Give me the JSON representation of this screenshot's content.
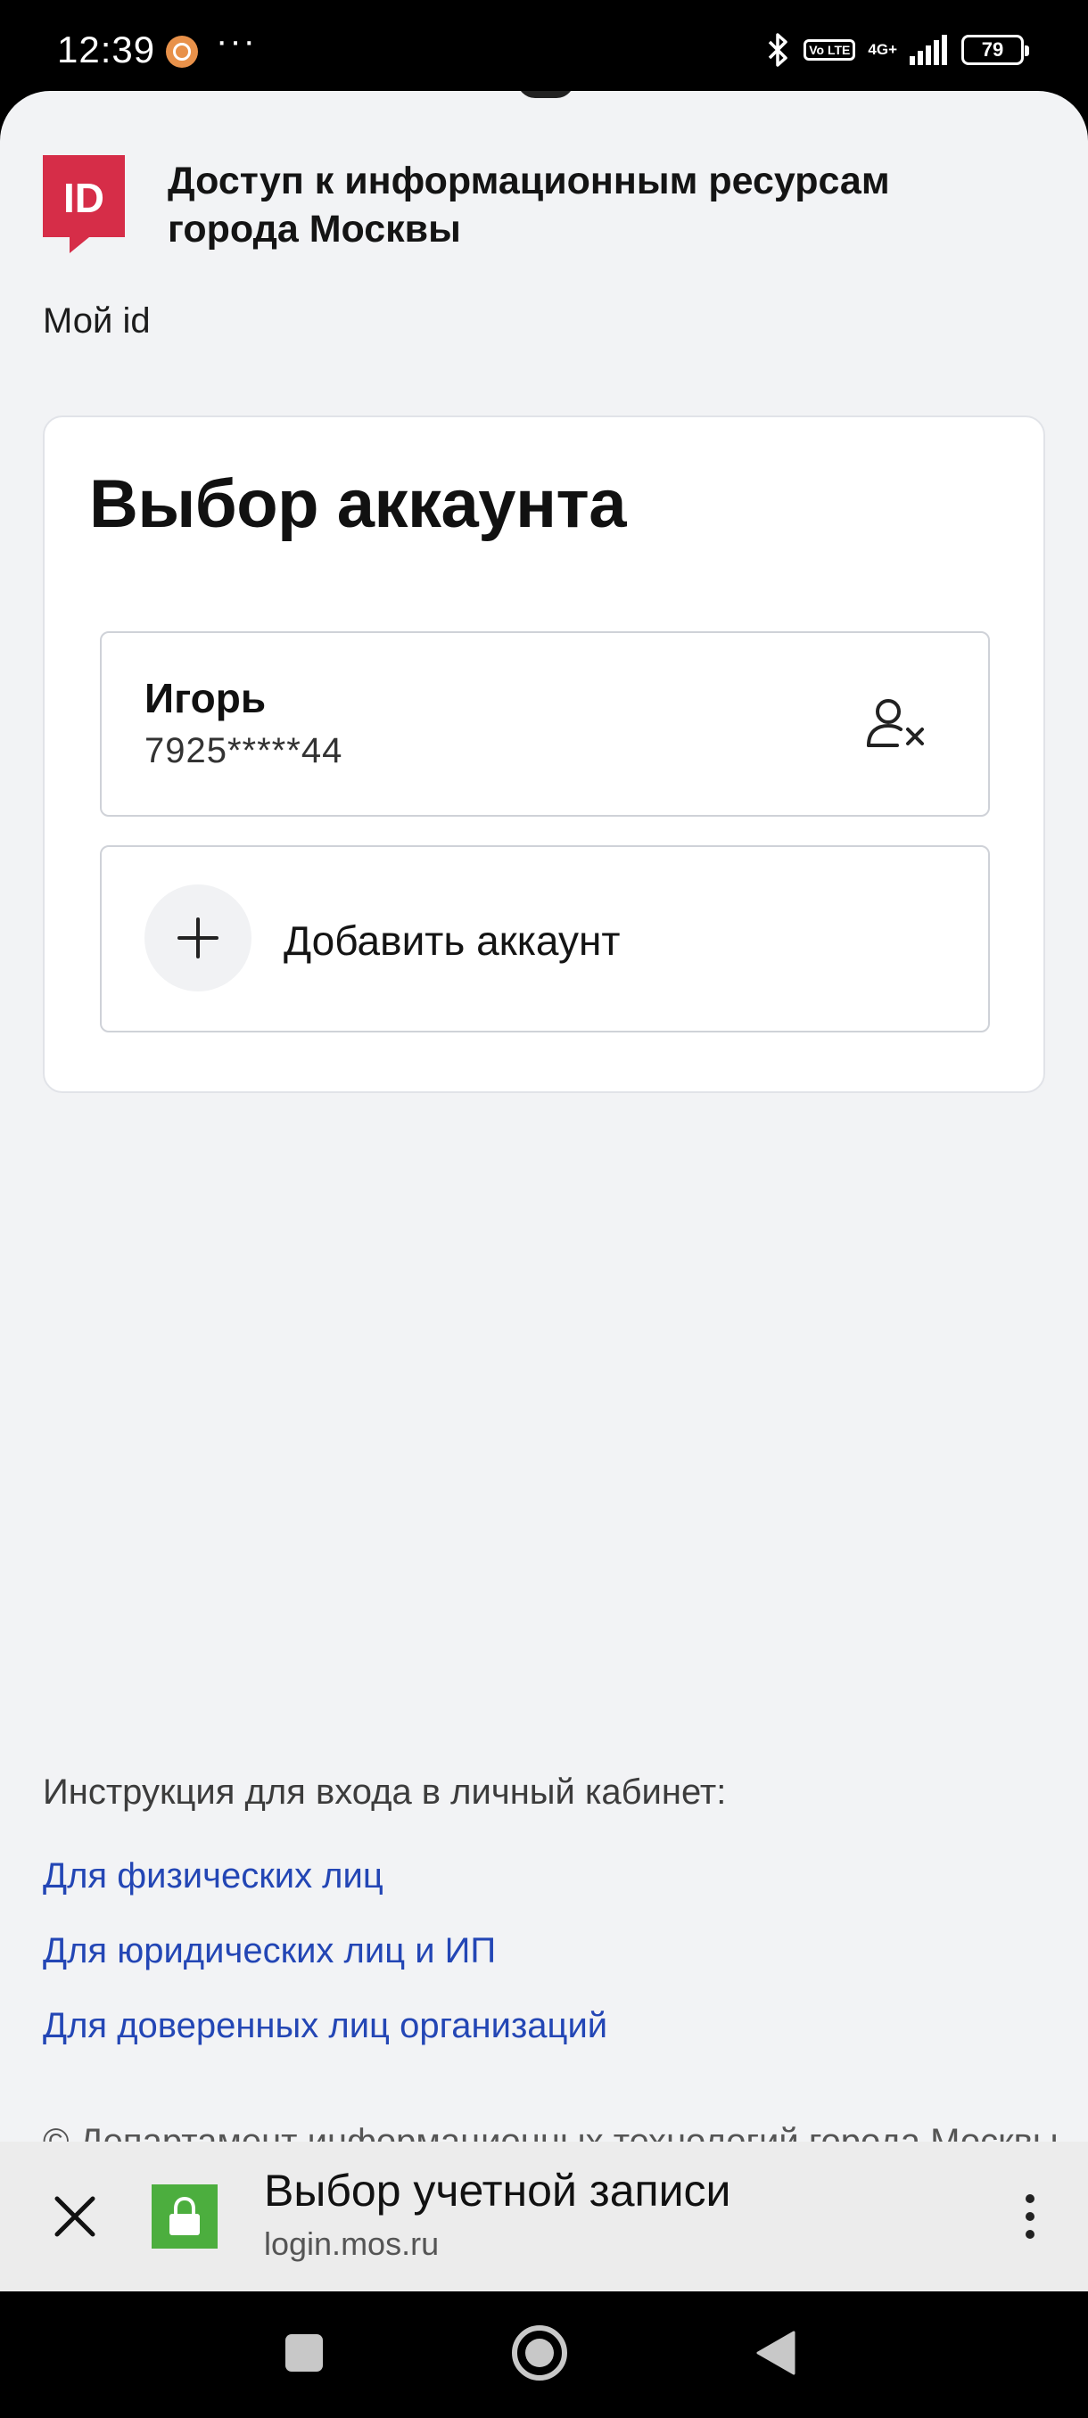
{
  "status_bar": {
    "time": "12:39",
    "dots": "···",
    "volte": "Vo LTE",
    "network": "4G+",
    "battery": "79"
  },
  "header": {
    "logo_text": "ID",
    "title": "Доступ к информационным ресурсам города Москвы",
    "subtitle": "Мой id"
  },
  "card": {
    "title": "Выбор аккаунта",
    "account": {
      "name": "Игорь",
      "phone": "7925*****44"
    },
    "add_account_label": "Добавить аккаунт"
  },
  "instructions": {
    "heading": "Инструкция для входа в личный кабинет:",
    "links": [
      "Для физических лиц",
      "Для юридических лиц и ИП",
      "Для доверенных лиц организаций"
    ],
    "footer": "© Департамент информационных технологий города Москвы"
  },
  "browser_bar": {
    "page_title": "Выбор учетной записи",
    "url": "login.mos.ru"
  },
  "colors": {
    "brand_red": "#d62d48",
    "link_blue": "#2346b5",
    "lock_green": "#4cae3e"
  }
}
